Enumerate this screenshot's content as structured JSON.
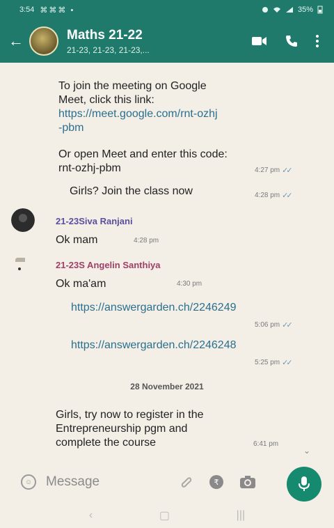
{
  "status_bar": {
    "time": "3:54",
    "notif_icons": "⌘⌘⌘ •",
    "right_text": "35%"
  },
  "header": {
    "title": "Maths 21-22",
    "subtitle": "21-23, 21-23, 21-23,..."
  },
  "messages": {
    "meet": {
      "line1": "To join the meeting on Google",
      "line2": "Meet, click this link:",
      "link1": "https://meet.google.com/rnt-ozhj",
      "link2": "-pbm",
      "line3": "Or open Meet and enter this code:",
      "code": "rnt-ozhj-pbm",
      "time": "4:27 pm"
    },
    "girls_join": {
      "text": "Girls? Join the class now",
      "time": "4:28 pm"
    },
    "siva": {
      "sender": "21-23Siva Ranjani",
      "text": "Ok mam",
      "time": "4:28 pm"
    },
    "angelin": {
      "sender": "21-23S Angelin Santhiya",
      "text": "Ok ma'am",
      "time": "4:30 pm"
    },
    "link_a": {
      "text": "https://answergarden.ch/2246249",
      "time": "5:06 pm"
    },
    "link_b": {
      "text": "https://answergarden.ch/2246248",
      "time": "5:25 pm"
    },
    "date": "28 November 2021",
    "entrepreneur": {
      "line1": "Girls, try now to register in the",
      "line2": "Entrepreneurship pgm and",
      "line3": "complete the course",
      "time": "6:41 pm"
    }
  },
  "composer": {
    "placeholder": "Message"
  },
  "colors": {
    "header": "#1f7a6c",
    "background": "#f3efe6",
    "mic": "#168a6f",
    "link": "#2a6f8e",
    "sender_siva": "#5a4f9e",
    "sender_angelin": "#9e3f6a"
  }
}
